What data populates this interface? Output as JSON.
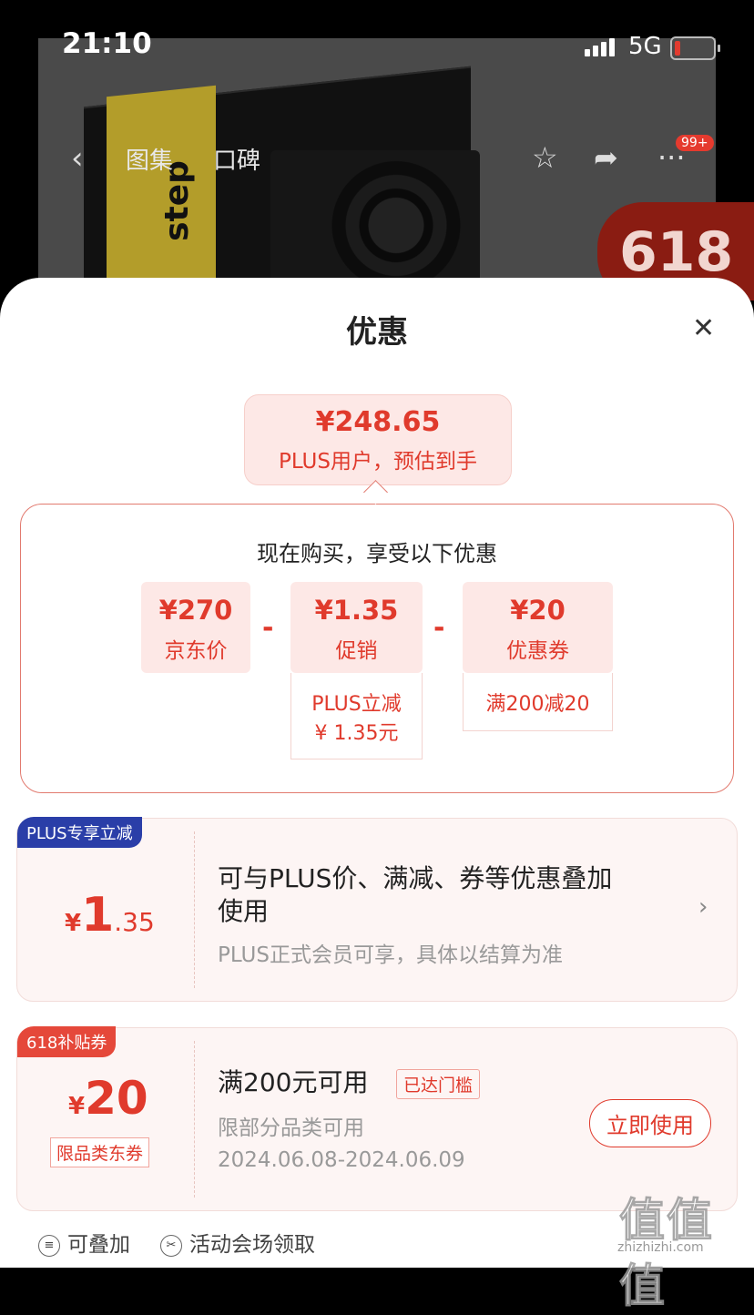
{
  "status": {
    "time": "21:10",
    "network": "5G"
  },
  "nav": {
    "tab1": "图集",
    "tab2": "口碑",
    "badge": "99+"
  },
  "promo": {
    "label": "618",
    "band_text": "step"
  },
  "sheet": {
    "title": "优惠",
    "estimate": {
      "price": "¥248.65",
      "note": "PLUS用户，预估到手"
    },
    "panel": {
      "heading": "现在购买，享受以下优惠",
      "items": [
        {
          "value": "¥270",
          "label": "京东价"
        },
        {
          "value": "¥1.35",
          "label": "促销",
          "detail": [
            "PLUS立减",
            "¥ 1.35元"
          ]
        },
        {
          "value": "¥20",
          "label": "优惠券",
          "detail": [
            "满200减20"
          ]
        }
      ],
      "operator": "-"
    },
    "plus_card": {
      "tag": "PLUS专享立减",
      "currency": "¥",
      "amount_int": "1",
      "amount_dec": ".35",
      "desc_line1": "可与PLUS价、满减、券等优惠叠加",
      "desc_line2": "使用",
      "note": "PLUS正式会员可享，具体以结算为准"
    },
    "coupon_card": {
      "tag": "618补贴券",
      "currency": "¥",
      "amount": "20",
      "limit": "限品类东券",
      "title": "满200元可用",
      "reached": "已达门槛",
      "scope": "限部分品类可用",
      "dates": "2024.06.08-2024.06.09",
      "button": "立即使用",
      "footer_stack": "可叠加",
      "footer_venue": "活动会场领取"
    }
  },
  "watermark": {
    "text": "值值值",
    "url": "zhizhizhi.com"
  },
  "colors": {
    "accent": "#e03a2c",
    "plus_tag": "#2a3ea8",
    "coupon_tag": "#e5483a",
    "chip_bg": "#fde8e6"
  }
}
